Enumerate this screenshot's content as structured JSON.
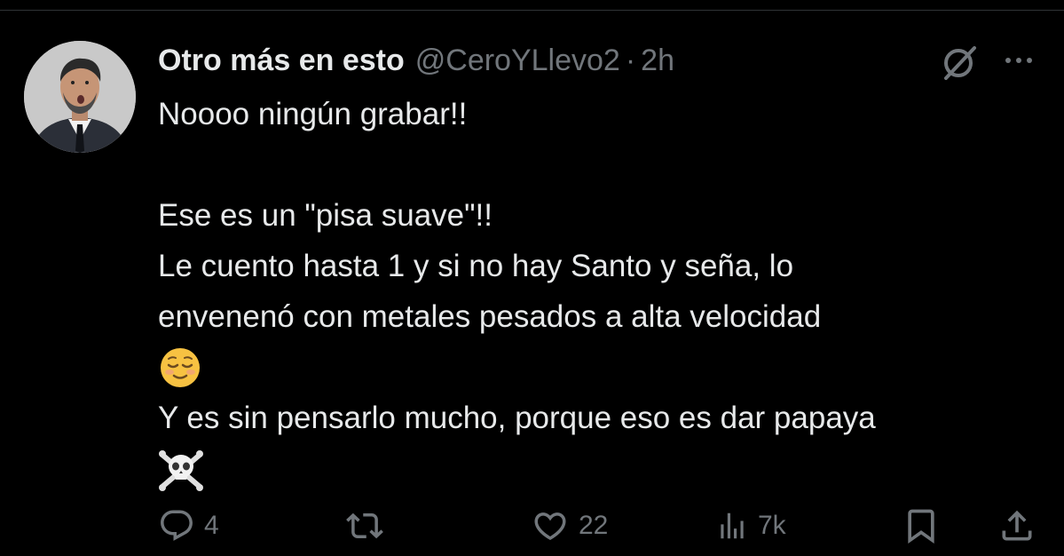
{
  "tweet": {
    "display_name": "Otro más en esto",
    "handle": "@CeroYLlevo2",
    "separator": "·",
    "time": "2h",
    "lines": [
      "Noooo ningún grabar!!",
      "",
      "Ese es un \"pisa suave\"!!",
      "Le cuento hasta 1 y si no hay Santo y seña, lo",
      "envenenó con metales pesados a alta velocidad",
      "😌",
      "Y es sin pensarlo mucho, porque eso es dar papaya",
      "☠️"
    ]
  },
  "actions": {
    "replies": "4",
    "retweets": "",
    "likes": "22",
    "views": "7k"
  },
  "icons": {
    "avatar": "avatar",
    "grok": "grok-icon",
    "more": "more-icon",
    "reply": "reply-icon",
    "retweet": "retweet-icon",
    "like": "heart-icon",
    "views": "views-icon",
    "bookmark": "bookmark-icon",
    "share": "share-icon"
  },
  "colors": {
    "background": "#000000",
    "text_primary": "#e7e9ea",
    "text_secondary": "#71767b",
    "divider": "#2f3336"
  }
}
